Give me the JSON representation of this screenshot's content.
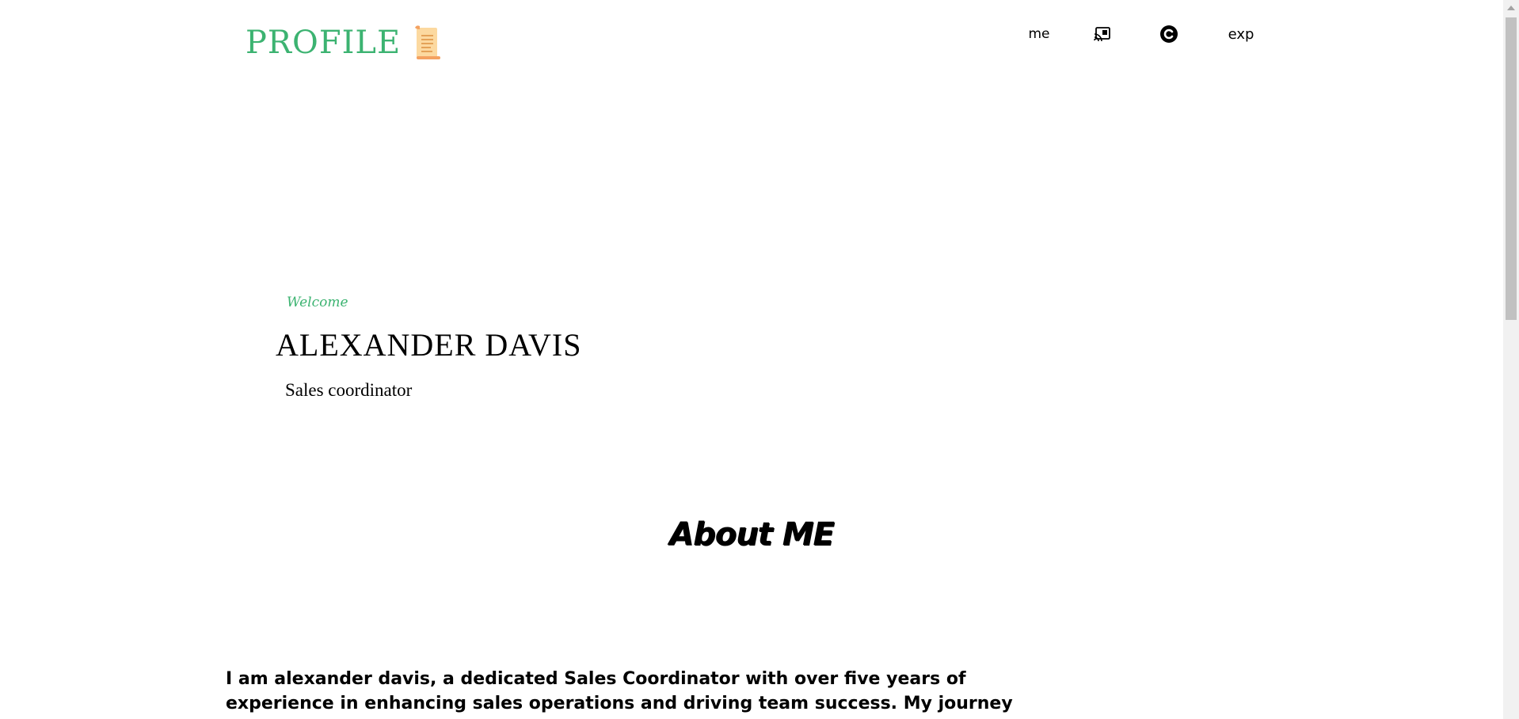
{
  "header": {
    "logo_text": "PROFILE",
    "logo_icon": "scroll-icon",
    "nav": [
      {
        "label": "me",
        "icon": null
      },
      {
        "label": "",
        "icon": "cast-icon"
      },
      {
        "label": "",
        "icon": "copyright-icon"
      },
      {
        "label": "exp",
        "icon": null
      }
    ]
  },
  "hero": {
    "welcome": "Welcome",
    "name": "ALEXANDER DAVIS",
    "role": "Sales coordinator"
  },
  "about": {
    "title": "About ME",
    "text": "I am alexander davis, a dedicated Sales Coordinator with over five years of experience in enhancing sales operations and driving team success. My journey in sales coordination has"
  },
  "colors": {
    "accent": "#3cb371",
    "text": "#000000",
    "background": "#ffffff",
    "scroll_paper": "#fcd9a0",
    "scroll_edge": "#f4a261"
  }
}
